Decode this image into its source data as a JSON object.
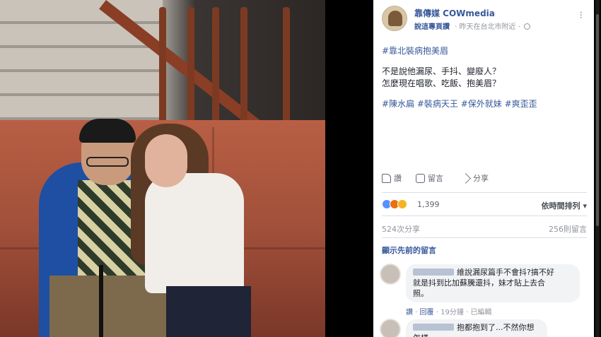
{
  "post": {
    "page_name": "靠傳媒 COWmedia",
    "view_page": "說這專頁讚",
    "meta": "· 昨天在台北市附近 ·",
    "hashtag_title": "#靠北裝病抱美眉",
    "line1": "不是說他漏尿、手抖、變廢人？",
    "line2": "怎麼現在唱歌、吃飯、抱美眉？",
    "tags": "#陳水扁 #裝病天王 #保外就妹 #爽歪歪"
  },
  "actions": {
    "like": "讚",
    "comment": "留言",
    "share": "分享"
  },
  "reactions": {
    "count": "1,399",
    "sort": "依時間排列 ▾"
  },
  "stats": {
    "shares": "524次分享",
    "comments": "256則留言"
  },
  "comments_section": {
    "show_previous": "顯示先前的留言"
  },
  "comment1": {
    "text_line1": "維說漏尿篇手不會抖?搞不好",
    "text_line2": "就是抖到比加蘇騰還抖，妹才貼上去合",
    "text_line3": "照。",
    "like": "讚",
    "reply": "回覆",
    "time": "· 19分鐘 · 已編輯"
  },
  "comment2": {
    "text_line1": "抱都抱到了...不然你想怎樣"
  },
  "colors": {
    "link_blue": "#365899",
    "text_dark": "#1d2129",
    "grey": "#90949c",
    "bubble": "#f2f3f5"
  }
}
